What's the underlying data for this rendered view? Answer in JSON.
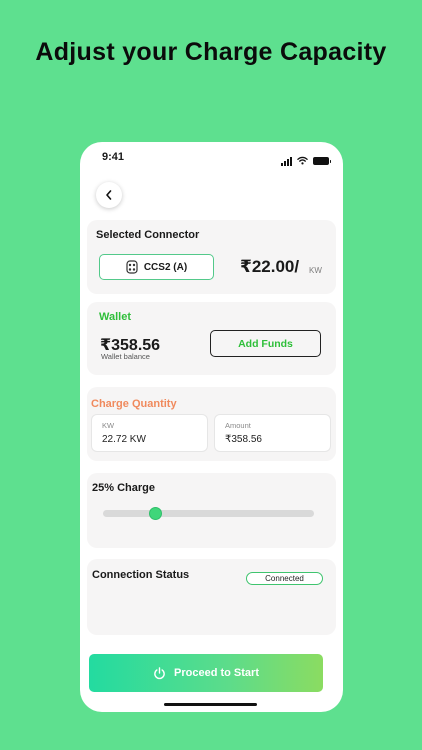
{
  "headline": "Adjust your Charge Capacity",
  "status_bar": {
    "time": "9:41"
  },
  "connector_card": {
    "title": "Selected Connector",
    "connector_label": "CCS2 (A)",
    "price": "₹22.00/",
    "price_unit": "KW"
  },
  "wallet_card": {
    "title": "Wallet",
    "balance": "₹358.56",
    "balance_label": "Wallet balance",
    "add_funds_label": "Add Funds"
  },
  "charge_quantity": {
    "title": "Charge Quantity",
    "kw_label": "KW",
    "kw_value": "22.72 KW",
    "amount_label": "Amount",
    "amount_value": "₹358.56"
  },
  "charge_slider": {
    "title": "25% Charge",
    "percent": 25
  },
  "connection_status": {
    "title": "Connection Status",
    "badge": "Connected"
  },
  "cta": {
    "label": "Proceed to Start"
  },
  "icons": {
    "back": "chevron-left-icon",
    "connector": "ev-plug-icon",
    "power": "power-icon",
    "signal": "signal-icon",
    "wifi": "wifi-icon",
    "battery": "battery-icon"
  },
  "colors": {
    "background": "#5ee08f",
    "accent_green": "#2fbf3a",
    "accent_orange": "#f08a5d",
    "cta_gradient_start": "#23dba0",
    "cta_gradient_end": "#8bdc61"
  }
}
